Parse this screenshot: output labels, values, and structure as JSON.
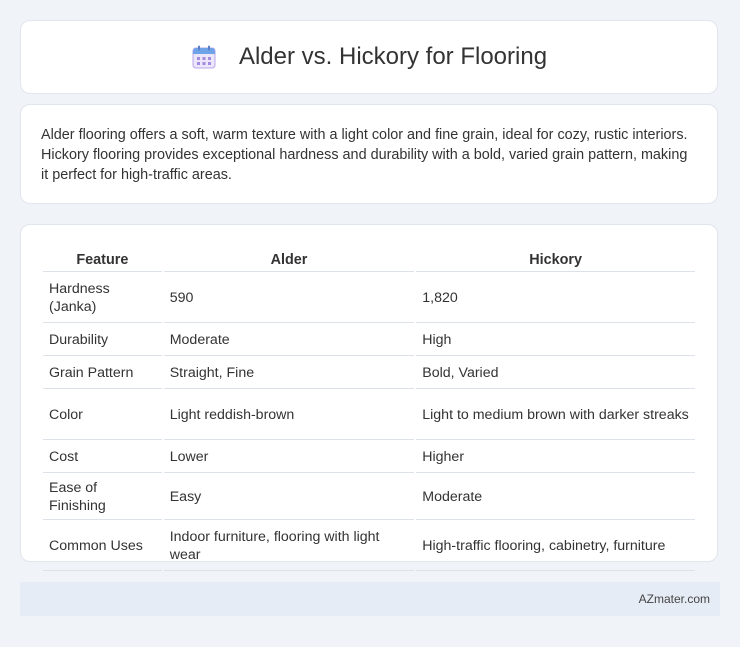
{
  "header": {
    "title": "Alder vs. Hickory for Flooring",
    "icon": "calendar-icon"
  },
  "description": {
    "text": "Alder flooring offers a soft, warm texture with a light color and fine grain, ideal for cozy, rustic interiors. Hickory flooring provides exceptional hardness and durability with a bold, varied grain pattern, making it perfect for high-traffic areas."
  },
  "table": {
    "headers": [
      "Feature",
      "Alder",
      "Hickory"
    ],
    "rows": [
      [
        "Hardness (Janka)",
        "590",
        "1,820"
      ],
      [
        "Durability",
        "Moderate",
        "High"
      ],
      [
        "Grain Pattern",
        "Straight, Fine",
        "Bold, Varied"
      ],
      [
        "Color",
        "Light reddish-brown",
        "Light to medium brown with darker streaks"
      ],
      [
        "Cost",
        "Lower",
        "Higher"
      ],
      [
        "Ease of Finishing",
        "Easy",
        "Moderate"
      ],
      [
        "Common Uses",
        "Indoor furniture, flooring with light wear",
        "High-traffic flooring, cabinetry, furniture"
      ]
    ]
  },
  "footer": {
    "text": "AZmater.com"
  },
  "colors": {
    "background": "#f0f3f8",
    "card": "#ffffff",
    "footer_bg": "#e6ecf5",
    "icon_accent": "#a58be0"
  }
}
